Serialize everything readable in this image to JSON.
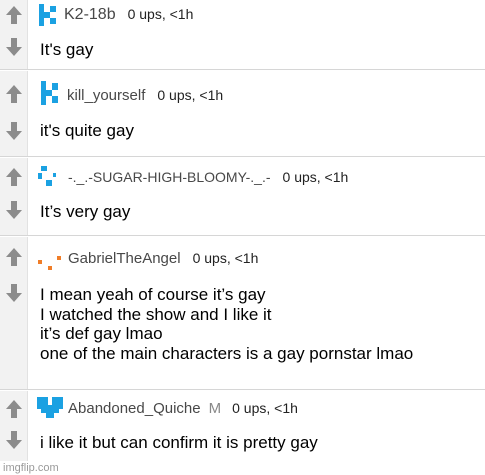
{
  "colors": {
    "vote_arrow": "#8c8c8c",
    "username": "#484848",
    "avatar_blue": "#1ba1e2",
    "avatar_orange": "#f07d28"
  },
  "comments": [
    {
      "avatar_icon": "blue-k-logo-icon",
      "username": "K2-18b",
      "stats": "0 ups, <1h",
      "lines": [
        "It's gay"
      ]
    },
    {
      "avatar_icon": "blue-k-logo-icon",
      "username": "kill_yourself",
      "stats": "0 ups, <1h",
      "lines": [
        "it's quite gay"
      ]
    },
    {
      "avatar_icon": "blue-pixel-icon",
      "username": "-._.-SUGAR-HIGH-BLOOMY-._.-",
      "stats": "0 ups, <1h",
      "lines": [
        "It’s very gay"
      ]
    },
    {
      "avatar_icon": "orange-dots-icon",
      "username": "GabrielTheAngel",
      "stats": "0 ups, <1h",
      "lines": [
        "I mean yeah of course it’s gay",
        "I watched the show and I like it",
        "it’s def gay lmao",
        "one of the main characters is a gay pornstar lmao"
      ]
    },
    {
      "avatar_icon": "blue-heart-icon",
      "username": "Abandoned_Quiche",
      "badge": "M",
      "stats": "0 ups, <1h",
      "lines": [
        "i like it but can confirm it is pretty gay"
      ]
    }
  ],
  "watermark": "imgflip.com"
}
